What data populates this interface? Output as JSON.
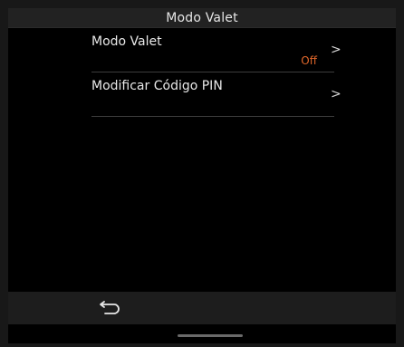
{
  "header": {
    "title": "Modo Valet"
  },
  "menu": {
    "items": [
      {
        "label": "Modo Valet",
        "value": "Off",
        "chevron": ">"
      },
      {
        "label": "Modificar Código PIN",
        "value": "",
        "chevron": ">"
      }
    ]
  },
  "footer": {
    "back_icon": "back-arrow-icon"
  },
  "colors": {
    "accent": "#e0662a",
    "background": "#000000",
    "bar": "#1d1d1d"
  }
}
